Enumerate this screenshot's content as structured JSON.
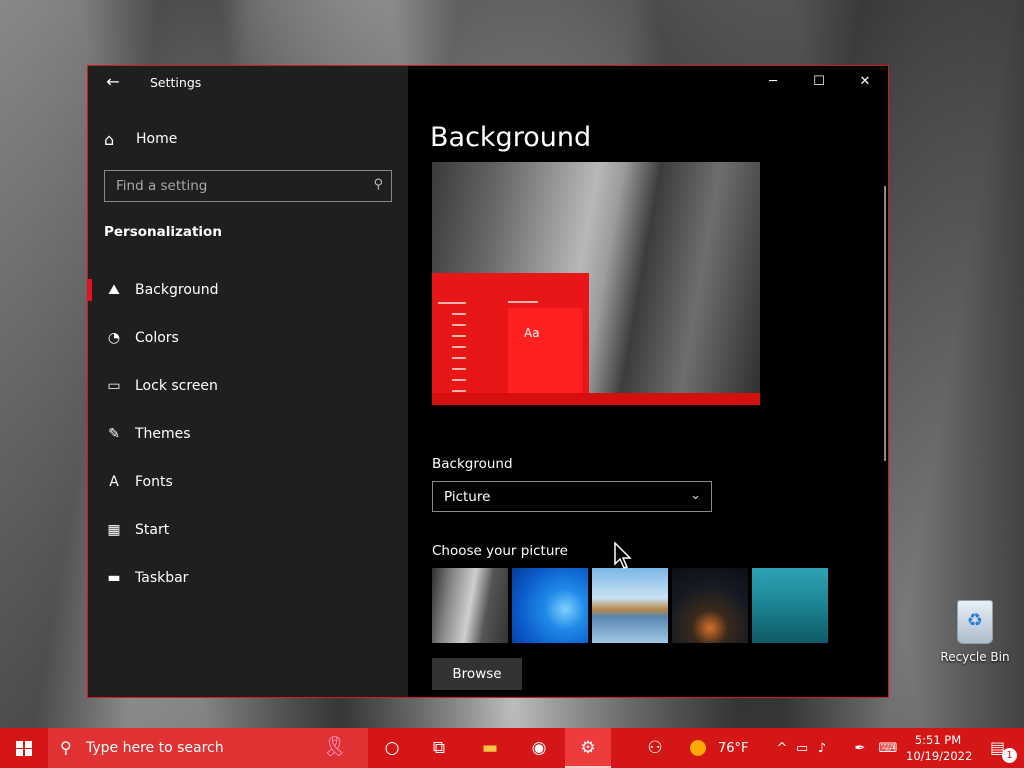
{
  "window": {
    "title": "Settings",
    "controls": {
      "minimize": "─",
      "maximize": "☐",
      "close": "✕"
    }
  },
  "sidebar": {
    "home_label": "Home",
    "search_placeholder": "Find a setting",
    "section_title": "Personalization",
    "items": [
      {
        "label": "Background",
        "icon": "picture-icon",
        "glyph": "⛰"
      },
      {
        "label": "Colors",
        "icon": "palette-icon",
        "glyph": "◔"
      },
      {
        "label": "Lock screen",
        "icon": "lock-screen-icon",
        "glyph": "▭"
      },
      {
        "label": "Themes",
        "icon": "themes-icon",
        "glyph": "✎"
      },
      {
        "label": "Fonts",
        "icon": "fonts-icon",
        "glyph": "A"
      },
      {
        "label": "Start",
        "icon": "start-icon",
        "glyph": "▦"
      },
      {
        "label": "Taskbar",
        "icon": "taskbar-icon",
        "glyph": "▬"
      }
    ],
    "active_index": 0
  },
  "main": {
    "page_title": "Background",
    "preview_sample": "Aa",
    "background_label": "Background",
    "background_value": "Picture",
    "choose_label": "Choose your picture",
    "browse_label": "Browse"
  },
  "desktop": {
    "recycle_bin_label": "Recycle Bin"
  },
  "taskbar": {
    "search_placeholder": "Type here to search",
    "weather_temp": "76°F",
    "time": "5:51 PM",
    "date": "10/19/2022",
    "notification_count": "1",
    "accent": "#d41616"
  }
}
